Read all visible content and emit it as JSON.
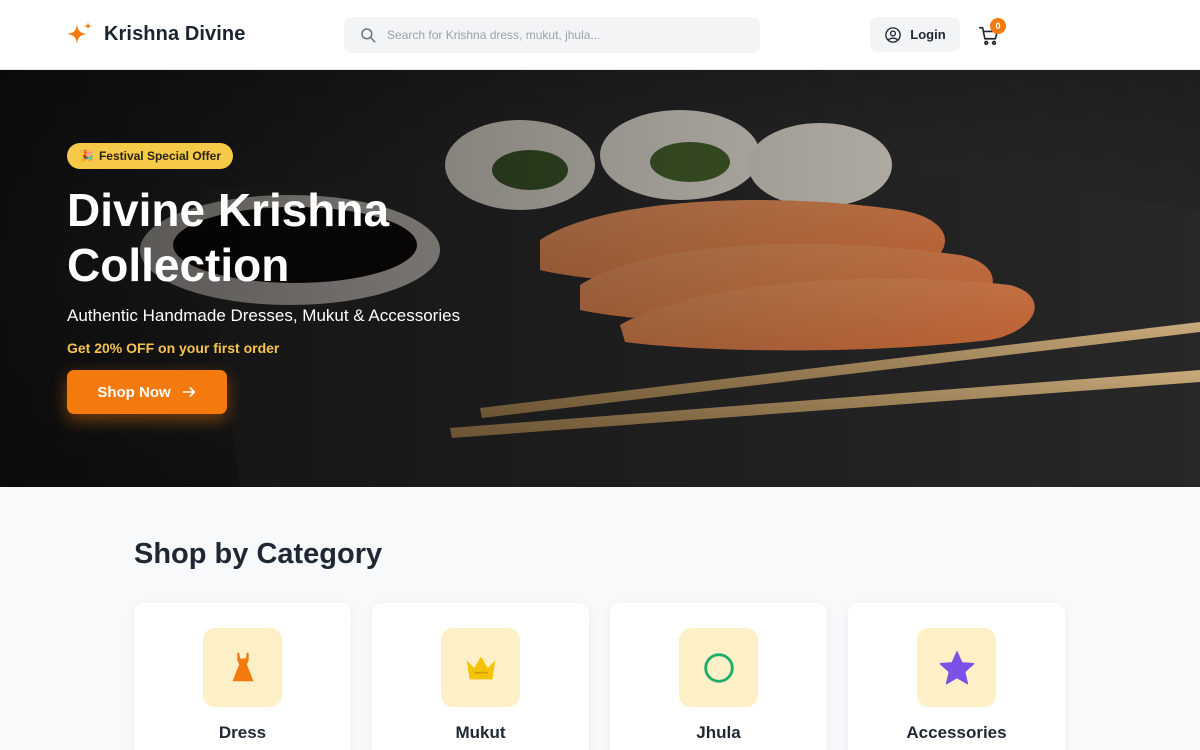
{
  "header": {
    "brand": "Krishna Divine",
    "search_placeholder": "Search for Krishna dress, mukut, jhula...",
    "login_label": "Login",
    "cart_count": "0"
  },
  "hero": {
    "badge": "Festival Special Offer",
    "badge_icon": "🎉",
    "title": "Divine Krishna Collection",
    "subtitle": "Authentic Handmade Dresses, Mukut & Accessories",
    "offer": "Get 20% OFF on your first order",
    "cta_label": "Shop Now"
  },
  "categories": {
    "title": "Shop by Category",
    "items": [
      {
        "label": "Dress",
        "icon": "dress-icon"
      },
      {
        "label": "Mukut",
        "icon": "crown-icon"
      },
      {
        "label": "Jhula",
        "icon": "circle-icon"
      },
      {
        "label": "Accessories",
        "icon": "star-icon"
      }
    ]
  },
  "colors": {
    "accent": "#f47a0d",
    "badge": "#f7c948",
    "offer_text": "#f6c34d",
    "icon_tile": "#fdf0c7"
  }
}
